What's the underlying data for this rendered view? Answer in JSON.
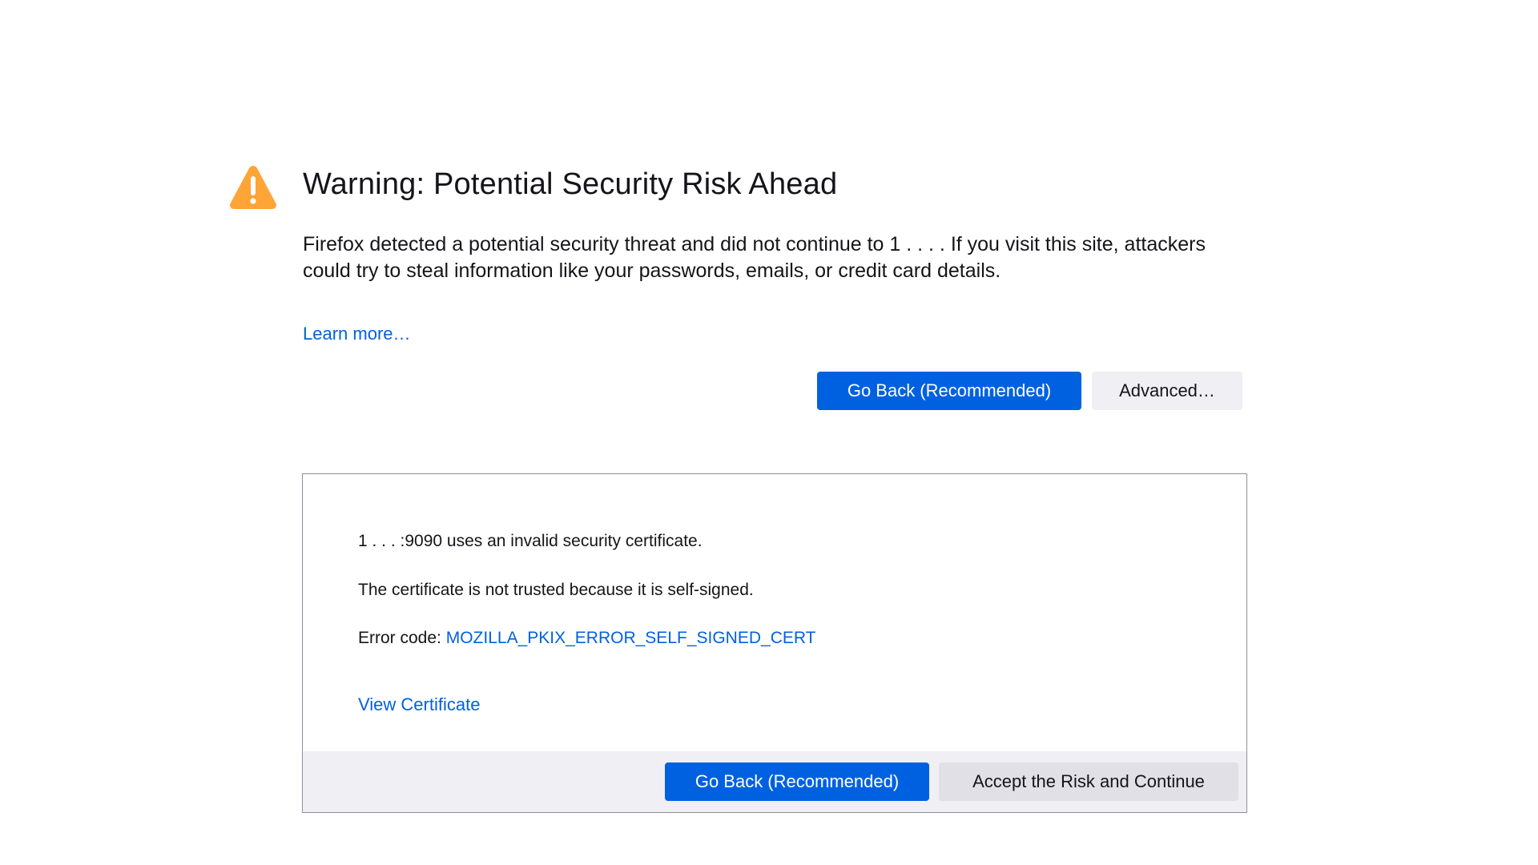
{
  "page": {
    "title": "Warning: Potential Security Risk Ahead",
    "description": "Firefox detected a potential security threat and did not continue to 1       .       .   .   . If you visit this site, attackers could try to steal information like your passwords, emails, or credit card details.",
    "learn_more_label": "Learn more…",
    "icon": "warning-triangle-icon"
  },
  "actions": {
    "go_back_label": "Go Back (Recommended)",
    "advanced_label": "Advanced…"
  },
  "advanced": {
    "invalid_cert_text": "1     .     .   . :9090 uses an invalid security certificate.",
    "reason_text": "The certificate is not trusted because it is self-signed.",
    "error_code_prefix": "Error code: ",
    "error_code": "MOZILLA_PKIX_ERROR_SELF_SIGNED_CERT",
    "view_certificate_label": "View Certificate",
    "go_back_label": "Go Back (Recommended)",
    "accept_label": "Accept the Risk and Continue"
  },
  "colors": {
    "accent": "#0061e0",
    "warning": "#ffa436",
    "button_secondary": "#f0f0f4"
  }
}
